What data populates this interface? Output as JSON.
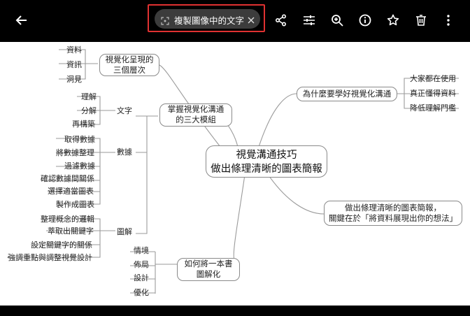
{
  "toolbar": {
    "chip_label": "複製圖像中的文字",
    "icons": [
      "back-arrow-icon",
      "share-icon",
      "adjust-icon",
      "zoom-in-icon",
      "info-icon",
      "star-icon",
      "delete-icon",
      "more-icon"
    ]
  },
  "mindmap": {
    "center": {
      "line1": "視覺溝通技巧",
      "line2": "做出條理清晰的圖表簡報"
    },
    "branch_levels": {
      "line1": "視覺化呈現的",
      "line2": "三個層次"
    },
    "levels": [
      "資料",
      "資訊",
      "洞見"
    ],
    "branch_three": {
      "line1": "掌握視覺化溝通",
      "line2": "的三大模組"
    },
    "text_label": "文字",
    "text_items": [
      "理解",
      "分解",
      "再構築"
    ],
    "data_label": "數據",
    "data_items": [
      "取得數據",
      "將數據整理",
      "過濾數據",
      "確認數據間關係",
      "選擇適當圖表",
      "製作成圖表"
    ],
    "diagram_label": "圖解",
    "diagram_items": [
      "整理概念的邏輯",
      "萃取出關鍵字",
      "設定關鍵字的關係",
      "強調重點與調整視覺設計"
    ],
    "branch_why": "為什麼要學好視覺化溝通",
    "why_items": [
      "大家都在使用",
      "真正懂得資料",
      "降低理解門檻"
    ],
    "branch_key": {
      "line1": "做出條理清晰的圖表簡報，",
      "line2": "關鍵在於「將資料展現出你的想法」"
    },
    "branch_how": {
      "line1": "如何將一本書",
      "line2": "圖解化"
    },
    "how_items": [
      "情境",
      "佈局",
      "設計",
      "優化"
    ]
  }
}
